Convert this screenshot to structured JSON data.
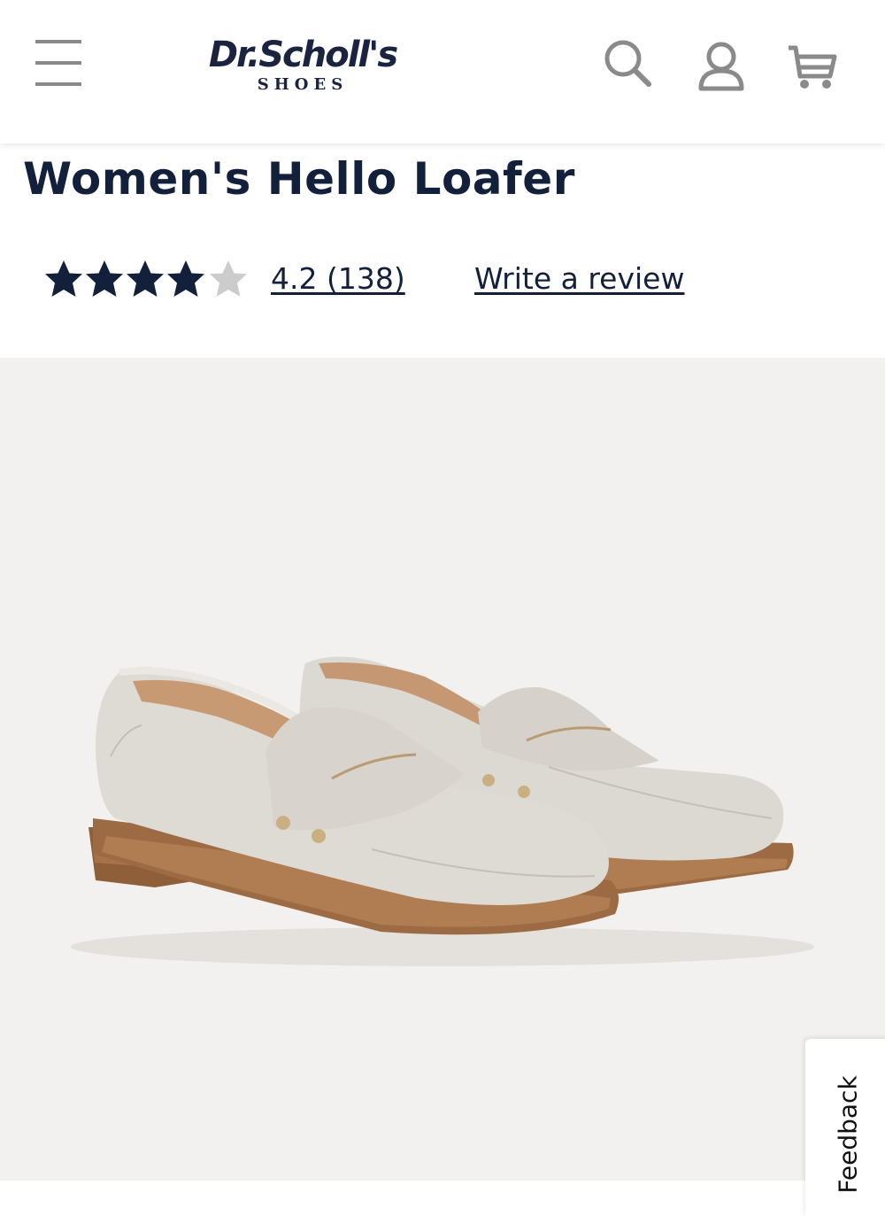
{
  "header": {
    "logo_main": "Dr.Scholl's",
    "logo_sub": "SHOES",
    "icons": [
      "menu-icon",
      "search-icon",
      "account-icon",
      "cart-icon"
    ]
  },
  "product": {
    "title": "Women's Hello Loafer",
    "rating_value": 4.2,
    "rating_max": 5,
    "rating_text": "4.2 (138)",
    "write_review_label": "Write a review",
    "image_alt": "Women's Hello Loafer pair"
  },
  "feedback": {
    "label": "Feedback"
  },
  "colors": {
    "brand_navy": "#13203b",
    "icon_gray": "#8a8a8a",
    "star_empty": "#cccccc",
    "image_background": "#f3f1ef"
  }
}
